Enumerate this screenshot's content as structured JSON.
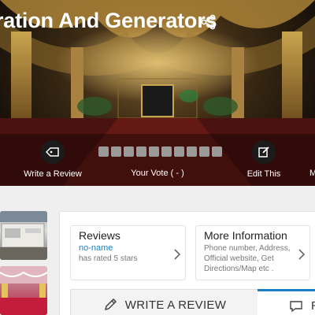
{
  "header": {
    "title": "ration And Generators",
    "share_icon": "share-icon"
  },
  "actions": {
    "write_review_label": "Write a Review",
    "your_vote_label": "Your Vote ( - )",
    "edit_this_label": "Edit This",
    "cut_label": "M"
  },
  "vote": {
    "boxes": 10,
    "selected": 0
  },
  "reviews_card": {
    "title": "Reviews",
    "user": "no-name",
    "rating_text": "has rated 5 stars"
  },
  "info_card": {
    "title": "More Information",
    "description": "Phone number, Address, Official website, Get Directions/Map etc ."
  },
  "tabs": {
    "write_review": "WRITE A REVIEW",
    "second_tab": "R"
  },
  "colors": {
    "accent": "#1a7fc2",
    "vote_box": "#9a9a9a"
  }
}
